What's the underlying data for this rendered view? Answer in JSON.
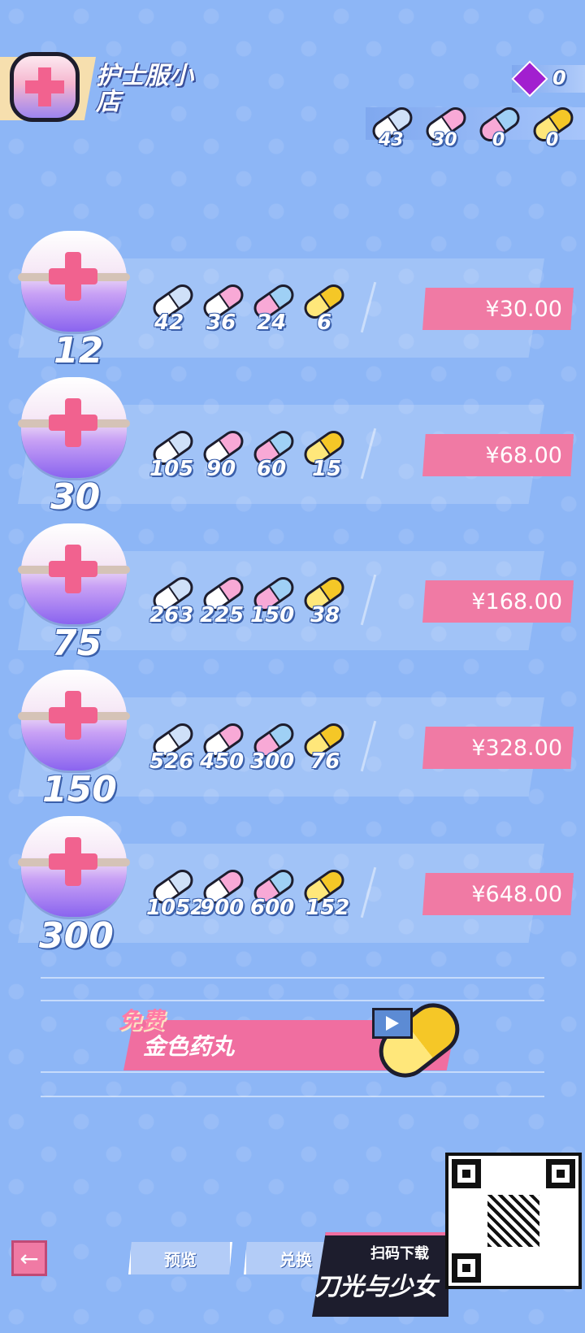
{
  "header": {
    "title": "护士服小店",
    "gem_count": "0",
    "resources": [
      {
        "type": "white",
        "icon": "white-pill-icon",
        "count": "43"
      },
      {
        "type": "pink",
        "icon": "pink-pill-icon",
        "count": "30"
      },
      {
        "type": "blue",
        "icon": "blue-pill-icon",
        "count": "0"
      },
      {
        "type": "gold",
        "icon": "gold-pill-icon",
        "count": "0"
      }
    ]
  },
  "packs": [
    {
      "count": "12",
      "items": [
        "42",
        "36",
        "24",
        "6"
      ],
      "price": "¥30.00"
    },
    {
      "count": "30",
      "items": [
        "105",
        "90",
        "60",
        "15"
      ],
      "price": "¥68.00"
    },
    {
      "count": "75",
      "items": [
        "263",
        "225",
        "150",
        "38"
      ],
      "price": "¥168.00"
    },
    {
      "count": "150",
      "items": [
        "526",
        "450",
        "300",
        "76"
      ],
      "price": "¥328.00"
    },
    {
      "count": "300",
      "items": [
        "1052",
        "900",
        "600",
        "152"
      ],
      "price": "¥648.00"
    }
  ],
  "free_offer": {
    "badge": "免费",
    "label": "金色药丸"
  },
  "bottom": {
    "preview_label": "预览",
    "exchange_label": "兑换",
    "promo_small": "扫码下载",
    "promo_big": "刀光与少女"
  },
  "colors": {
    "background": "#8db6f6",
    "price_button": "#f07aa4",
    "accent_pink": "#f06ea0",
    "gem": "#a21fcf"
  }
}
